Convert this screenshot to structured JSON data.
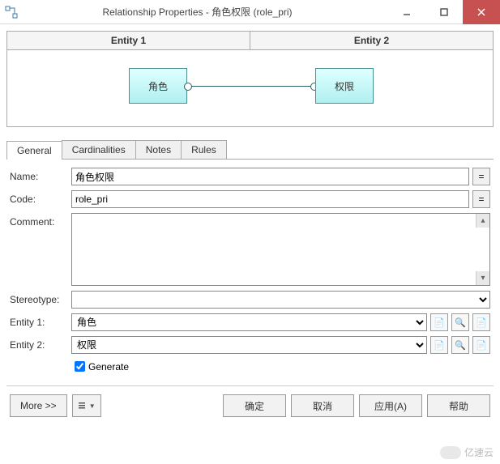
{
  "window": {
    "title": "Relationship Properties - 角色权限 (role_pri)"
  },
  "entity_headers": {
    "e1": "Entity 1",
    "e2": "Entity 2"
  },
  "diagram": {
    "box1": "角色",
    "box2": "权限"
  },
  "tabs": {
    "general": "General",
    "cardinalities": "Cardinalities",
    "notes": "Notes",
    "rules": "Rules"
  },
  "labels": {
    "name": "Name:",
    "code": "Code:",
    "comment": "Comment:",
    "stereotype": "Stereotype:",
    "entity1": "Entity 1:",
    "entity2": "Entity 2:",
    "generate": "Generate"
  },
  "values": {
    "name": "角色权限",
    "code": "role_pri",
    "stereotype": "",
    "entity1": "角色",
    "entity2": "权限"
  },
  "buttons": {
    "eq": "=",
    "more": "More >>",
    "ok": "确定",
    "cancel": "取消",
    "apply": "应用(A)",
    "help": "帮助"
  },
  "icon_glyphs": {
    "prop": "📄",
    "find": "🔍",
    "new": "📄"
  },
  "watermark": "亿速云"
}
